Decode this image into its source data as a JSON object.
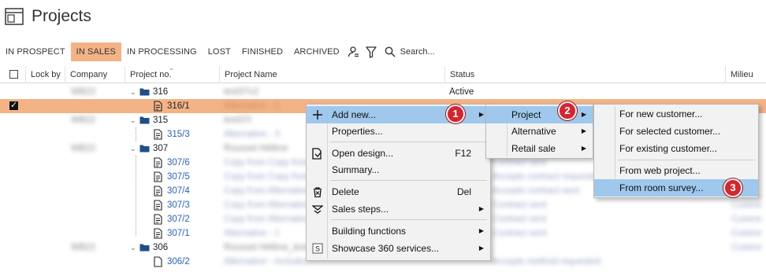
{
  "page": {
    "title": "Projects",
    "title_icon": "window-icon"
  },
  "tabs": [
    {
      "label": "IN PROSPECT",
      "active": false
    },
    {
      "label": "IN SALES",
      "active": true
    },
    {
      "label": "IN PROCESSING",
      "active": false
    },
    {
      "label": "LOST",
      "active": false
    },
    {
      "label": "FINISHED",
      "active": false
    },
    {
      "label": "ARCHIVED",
      "active": false
    }
  ],
  "toolbar": {
    "user_filter_icon": "user-filter-icon",
    "filter_icon": "funnel-icon",
    "search_icon": "magnifier-icon",
    "search_placeholder": "Search..."
  },
  "columns": {
    "lock_by": "Lock by",
    "company": "Company",
    "project_no": "Project no.",
    "project_name": "Project Name",
    "status": "Status",
    "milieu": "Milieu"
  },
  "rows": [
    {
      "kind": "folder",
      "number": "316",
      "company": "WB22",
      "name": "test37n2",
      "status": "Active"
    },
    {
      "kind": "doc",
      "number": "316/1",
      "name": "Alternative - 1",
      "selected": true
    },
    {
      "kind": "folder",
      "number": "315",
      "company": "WB22",
      "name": "test37t"
    },
    {
      "kind": "doc",
      "number": "315/3",
      "name": "Alternative - 3"
    },
    {
      "kind": "folder",
      "number": "307",
      "company": "WB22",
      "name": "Rousset Hélène"
    },
    {
      "kind": "doc",
      "number": "307/6",
      "name": "Copy from Copy from",
      "status": "Contract sent"
    },
    {
      "kind": "doc",
      "number": "307/5",
      "name": "Copy from Copy from",
      "status": "Accepts contract requested"
    },
    {
      "kind": "doc",
      "number": "307/4",
      "name": "Copy from Alternative",
      "status": "Accepts contract sent"
    },
    {
      "kind": "doc",
      "number": "307/3",
      "name": "Copy from Alternative",
      "status": "Contract sent"
    },
    {
      "kind": "doc",
      "number": "307/2",
      "name": "Copy from Alternative",
      "status": "Contract sent"
    },
    {
      "kind": "doc",
      "number": "307/1",
      "name": "Alternative - 1",
      "status": "Contract sent"
    },
    {
      "kind": "folder",
      "number": "306",
      "company": "WB22",
      "name": "Rousset Hélène_test"
    },
    {
      "kind": "doc",
      "number": "306/2",
      "name": "Alternative - Included",
      "status": "Accepts method requested"
    }
  ],
  "milieu_values": [
    "Cuisine",
    "Cuisine",
    "Cuisine",
    "Cuisine"
  ],
  "context_menu": {
    "items": [
      {
        "label": "Add new...",
        "icon": "plus-icon",
        "submenu": true,
        "highlighted": true
      },
      {
        "label": "Properties..."
      },
      {
        "label": "Open design...",
        "icon": "open-design-icon",
        "shortcut": "F12"
      },
      {
        "label": "Summary..."
      },
      {
        "label": "Delete",
        "icon": "trash-icon",
        "shortcut": "Del"
      },
      {
        "label": "Sales steps...",
        "icon": "sales-steps-icon",
        "submenu": true
      },
      {
        "label": "Building functions",
        "submenu": true
      },
      {
        "label": "Showcase 360 services...",
        "icon": "showcase-s-icon",
        "submenu": true
      }
    ]
  },
  "submenu_project": {
    "items": [
      {
        "label": "Project",
        "highlighted": true,
        "submenu": true
      },
      {
        "label": "Alternative",
        "submenu": true
      },
      {
        "label": "Retail sale",
        "submenu": true
      }
    ]
  },
  "submenu_new_project": {
    "items": [
      {
        "label": "For new customer..."
      },
      {
        "label": "For selected customer..."
      },
      {
        "label": "For existing customer..."
      },
      {
        "label": "From web project..."
      },
      {
        "label": "From room survey...",
        "highlighted": true
      }
    ]
  },
  "steps": [
    "1",
    "2",
    "3"
  ],
  "colors": {
    "selected_row": "#f3b386",
    "menu_highlight": "#9fc8ec",
    "badge": "#d22630",
    "link": "#2a63b8"
  }
}
